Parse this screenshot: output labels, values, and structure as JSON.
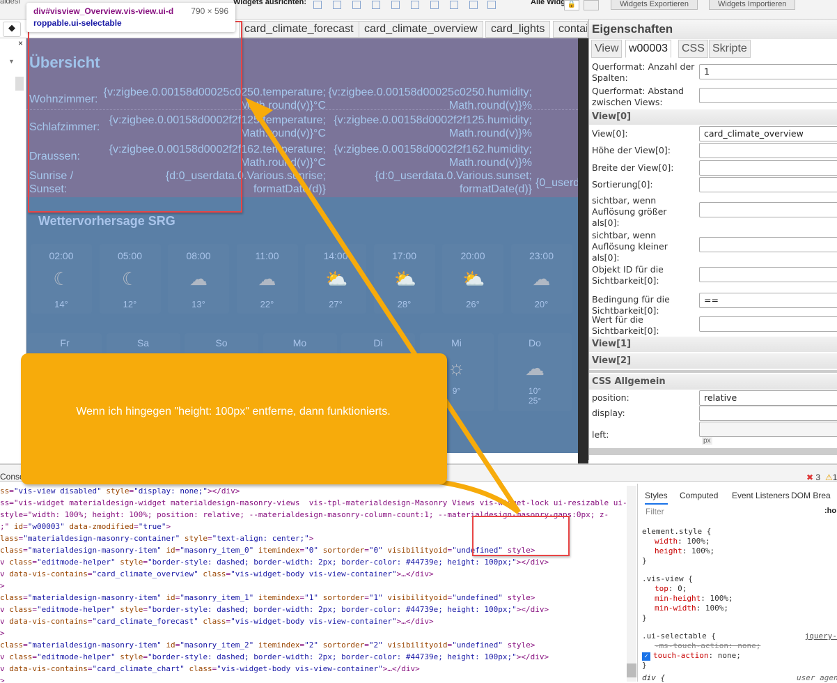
{
  "toolbar": {
    "left_text": "aldesi",
    "align_label": "Widgets ausrichten:",
    "all_widgets_label": "Alle Widgets:",
    "export_button": "Widgets Exportieren",
    "import_button": "Widgets Importieren"
  },
  "tooltip": {
    "selector": "div#visview_Overview.vis-view.ui-d",
    "selector_cont": "roppable.ui-selectable",
    "size": "790 × 596"
  },
  "view_tabs": [
    "card_climate_forecast",
    "card_climate_overview",
    "card_lights",
    "contai"
  ],
  "overview": {
    "title": "Übersicht",
    "rows": [
      {
        "label": "Wohnzimmer:",
        "temp": [
          "{v:zigbee.0.00158d00025c0250.temperature;",
          "Math.round(v)}°C"
        ],
        "hum": [
          "{v:zigbee.0.00158d00025c0250.humidity;",
          "Math.round(v)}%"
        ]
      },
      {
        "label": "Schlafzimmer:",
        "temp": [
          "{v:zigbee.0.00158d0002f2f125.temperature;",
          "Math.round(v)}°C"
        ],
        "hum": [
          "{v:zigbee.0.00158d0002f2f125.humidity;",
          "Math.round(v)}%"
        ]
      },
      {
        "label": "Draussen:",
        "temp": [
          "{v:zigbee.0.00158d0002f2f162.temperature;",
          "Math.round(v)}°C"
        ],
        "hum": [
          "{v:zigbee.0.00158d0002f2f162.humidity;",
          "Math.round(v)}%"
        ]
      }
    ],
    "sun": {
      "label": [
        "Sunrise /",
        "Sunset:"
      ],
      "rise": [
        "{d:0_userdata.0.Various.sunrise;",
        "formatDate(d)}"
      ],
      "set": [
        "{d:0_userdata.0.Various.sunset;",
        "formatDate(d)}"
      ],
      "extra": "{0_userd"
    }
  },
  "forecast": {
    "title": "Wettervorhersage SRG",
    "hourly": [
      {
        "time": "02:00",
        "icon": "moon-icon",
        "temp": "14°"
      },
      {
        "time": "05:00",
        "icon": "moon-icon",
        "temp": "12°"
      },
      {
        "time": "08:00",
        "icon": "moon-cloud-icon",
        "temp": "13°"
      },
      {
        "time": "11:00",
        "icon": "cloud-sun-icon",
        "temp": "22°"
      },
      {
        "time": "14:00",
        "icon": "sun-cloud-icon",
        "temp": "27°"
      },
      {
        "time": "17:00",
        "icon": "sun-cloud-icon",
        "temp": "28°"
      },
      {
        "time": "20:00",
        "icon": "sun-cloud-icon",
        "temp": "26°"
      },
      {
        "time": "23:00",
        "icon": "cloud-moon-icon",
        "temp": "20°"
      }
    ],
    "daily": [
      {
        "day": "Fr",
        "icon": "",
        "temp": ""
      },
      {
        "day": "Sa",
        "icon": "",
        "temp": ""
      },
      {
        "day": "So",
        "icon": "",
        "temp": ""
      },
      {
        "day": "Mo",
        "icon": "",
        "temp": ""
      },
      {
        "day": "Di",
        "icon": "",
        "temp": ""
      },
      {
        "day": "Mi",
        "icon": "sun-icon",
        "temp": "9°"
      },
      {
        "day": "Do",
        "icon": "cloud-sun-icon",
        "temp": "10°\n25°"
      }
    ]
  },
  "properties": {
    "title": "Eigenschaften",
    "tabs": [
      "View",
      "w00003",
      "CSS",
      "Skripte"
    ],
    "fields": [
      {
        "label": "Querformat: Anzahl der Spalten:",
        "value": "1"
      },
      {
        "label": "Querformat: Abstand zwischen Views:",
        "value": ""
      }
    ],
    "sections": {
      "view0": "View[0]",
      "view1": "View[1]",
      "view2": "View[2]",
      "css": "CSS Allgemein"
    },
    "view0_fields": [
      {
        "label": "View[0]:",
        "value": "card_climate_overview"
      },
      {
        "label": "Höhe der View[0]:",
        "value": ""
      },
      {
        "label": "Breite der View[0]:",
        "value": ""
      },
      {
        "label": "Sortierung[0]:",
        "value": ""
      },
      {
        "label": "sichtbar, wenn Auflösung größer als[0]:",
        "value": ""
      },
      {
        "label": "sichtbar, wenn Auflösung kleiner als[0]:",
        "value": ""
      },
      {
        "label": "Objekt ID für die Sichtbarkeit[0]:",
        "value": ""
      },
      {
        "label": "Bedingung für die Sichtbarkeit[0]:",
        "value": "=="
      },
      {
        "label": "Wert für die Sichtbarkeit[0]:",
        "value": ""
      }
    ],
    "css_fields": [
      {
        "label": "position:",
        "value": "relative"
      },
      {
        "label": "display:",
        "value": ""
      },
      {
        "label": "left:",
        "value": "",
        "unit": "px"
      }
    ]
  },
  "devtools": {
    "console_tab": "Console",
    "errors": "3",
    "warnings": "1",
    "code": [
      "ss=\"vis-view disabled\" style=\"display: none;\"></div>",
      "ss=\"vis-widget materialdesign-widget materialdesign-masonry-views  vis-tpl-materialdesign-Masonry Views vis-widget-lock ui-resizable ui-",
      "style=\"width: 100%; height: 100%; position: relative; --materialdesign-masonry-column-count:1; --materialdesign-masonry-gaps:0px; z-",
      ";\" id=\"w00003\" data-zmodified=\"true\">",
      "lass=\"materialdesign-masonry-container\" style=\"text-align: center;\">",
      "class=\"materialdesign-masonry-item\" id=\"masonry_item_0\" itemindex=\"0\" sortorder=\"0\" visibilityoid=\"undefined\" style>",
      "v class=\"editmode-helper\" style=\"border-style: dashed; border-width: 2px; border-color: #44739e; height: 100px;\"></div>",
      "v data-vis-contains=\"card_climate_overview\" class=\"vis-widget-body vis-view-container\">…</div>",
      ">",
      "class=\"materialdesign-masonry-item\" id=\"masonry_item_1\" itemindex=\"1\" sortorder=\"1\" visibilityoid=\"undefined\" style>",
      "v class=\"editmode-helper\" style=\"border-style: dashed; border-width: 2px; border-color: #44739e; height: 100px;\"></div>",
      "v data-vis-contains=\"card_climate_forecast\" class=\"vis-widget-body vis-view-container\">…</div>",
      ">",
      "class=\"materialdesign-masonry-item\" id=\"masonry_item_2\" itemindex=\"2\" sortorder=\"2\" visibilityoid=\"undefined\" style>",
      "v class=\"editmode-helper\" style=\"border-style: dashed; border-width: 2px; border-color: #44739e; height: 100px;\"></div>",
      "v data-vis-contains=\"card_climate_chart\" class=\"vis-widget-body vis-view-container\">…</div>",
      ">"
    ],
    "styles_tabs": [
      "Styles",
      "Computed",
      "Event Listeners",
      "DOM Brea"
    ],
    "filter_placeholder": "Filter",
    "hov": ":ho",
    "rules": [
      {
        "selector": "element.style {",
        "props": [
          [
            "width",
            "100%"
          ],
          [
            "height",
            "100%"
          ]
        ]
      },
      {
        "selector": ".vis-view {",
        "props": [
          [
            "top",
            "0"
          ],
          [
            "min-height",
            "100%"
          ],
          [
            "min-width",
            "100%"
          ]
        ]
      },
      {
        "selector": ".ui-selectable {",
        "source": "jquery-",
        "struck": "-ms-touch-action: none;",
        "props": [
          [
            "touch-action",
            "none"
          ]
        ]
      }
    ],
    "last_rule": "div {",
    "last_source": "user agen"
  },
  "callout": {
    "text": "Wenn ich hingegen \"height: 100px\" entferne, dann funktionierts.",
    "color": "#f7ab0b"
  },
  "colors": {
    "overview_bg": "#7b7499",
    "canvas_bg": "#5a7fa6",
    "highlight_red": "#e84545"
  }
}
